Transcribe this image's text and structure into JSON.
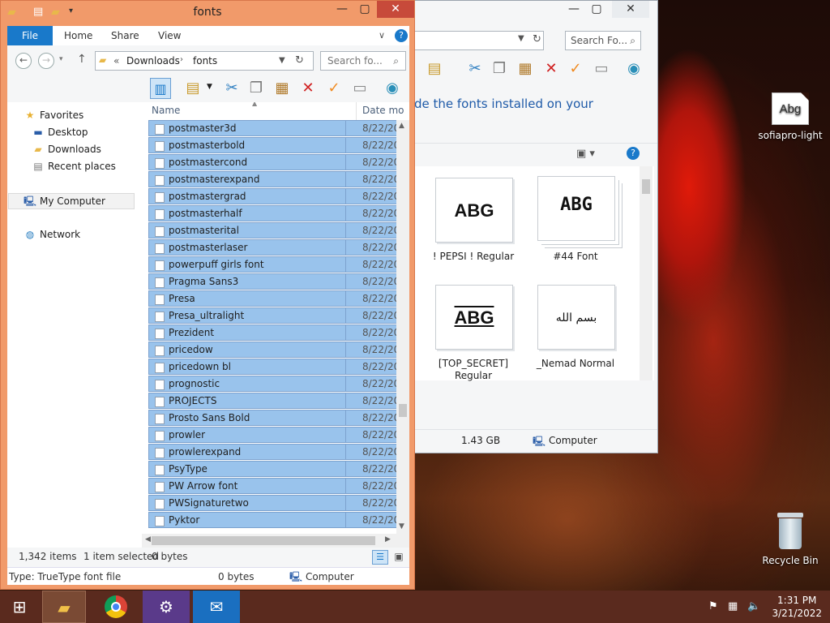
{
  "desktop": {
    "font_icon": {
      "preview": "Abg",
      "label": "sofiapro-light"
    },
    "recycle_bin": {
      "label": "Recycle Bin"
    }
  },
  "window_back": {
    "search_placeholder": "Search Fo...",
    "message": "de the fonts installed on your",
    "thumbnails": [
      {
        "preview": "ABG",
        "label": "! PEPSI ! Regular"
      },
      {
        "preview": "ABG",
        "label": "#44 Font"
      },
      {
        "preview": "ABG",
        "label": "[TOP_SECRET] Regular"
      },
      {
        "preview": "بسم الله",
        "label": "_Nemad Normal"
      }
    ],
    "status": {
      "size": "1.43 GB",
      "location": "Computer"
    }
  },
  "window_front": {
    "title": "fonts",
    "ribbon_tabs": {
      "file": "File",
      "home": "Home",
      "share": "Share",
      "view": "View"
    },
    "breadcrumb": {
      "sep": "«",
      "part1": "Downloads",
      "part2": "fonts"
    },
    "search_placeholder": "Search fo...",
    "columns": {
      "name": "Name",
      "date": "Date mo"
    },
    "nav": {
      "favorites": "Favorites",
      "desktop": "Desktop",
      "downloads": "Downloads",
      "recent": "Recent places",
      "computer": "My Computer",
      "network": "Network"
    },
    "files": [
      {
        "name": "postmaster3d",
        "date": "8/22/20"
      },
      {
        "name": "postmasterbold",
        "date": "8/22/20"
      },
      {
        "name": "postmastercond",
        "date": "8/22/20"
      },
      {
        "name": "postmasterexpand",
        "date": "8/22/20"
      },
      {
        "name": "postmastergrad",
        "date": "8/22/20"
      },
      {
        "name": "postmasterhalf",
        "date": "8/22/20"
      },
      {
        "name": "postmasterital",
        "date": "8/22/20"
      },
      {
        "name": "postmasterlaser",
        "date": "8/22/20"
      },
      {
        "name": "powerpuff girls font",
        "date": "8/22/20"
      },
      {
        "name": "Pragma Sans3",
        "date": "8/22/20"
      },
      {
        "name": "Presa",
        "date": "8/22/20"
      },
      {
        "name": "Presa_ultralight",
        "date": "8/22/20"
      },
      {
        "name": "Prezident",
        "date": "8/22/20"
      },
      {
        "name": "pricedow",
        "date": "8/22/20"
      },
      {
        "name": "pricedown bl",
        "date": "8/22/20"
      },
      {
        "name": "prognostic",
        "date": "8/22/20"
      },
      {
        "name": "PROJECTS",
        "date": "8/22/20"
      },
      {
        "name": "Prosto Sans Bold",
        "date": "8/22/20"
      },
      {
        "name": "prowler",
        "date": "8/22/20"
      },
      {
        "name": "prowlerexpand",
        "date": "8/22/20"
      },
      {
        "name": "PsyType",
        "date": "8/22/20"
      },
      {
        "name": "PW Arrow font",
        "date": "8/22/20"
      },
      {
        "name": "PWSignaturetwo",
        "date": "8/22/20"
      },
      {
        "name": "Pyktor",
        "date": "8/22/20"
      }
    ],
    "status": {
      "items": "1,342 items",
      "selected": "1 item selected",
      "size": "0 bytes"
    },
    "details": {
      "type": "Type: TrueType font file",
      "size": "0 bytes",
      "location": "Computer"
    }
  },
  "taskbar": {
    "time": "1:31 PM",
    "date": "3/21/2022"
  },
  "colors": {
    "accent": "#1979ca",
    "selection": "#99c3ec",
    "window_frame": "#f19a6a",
    "close": "#c74a3a"
  }
}
